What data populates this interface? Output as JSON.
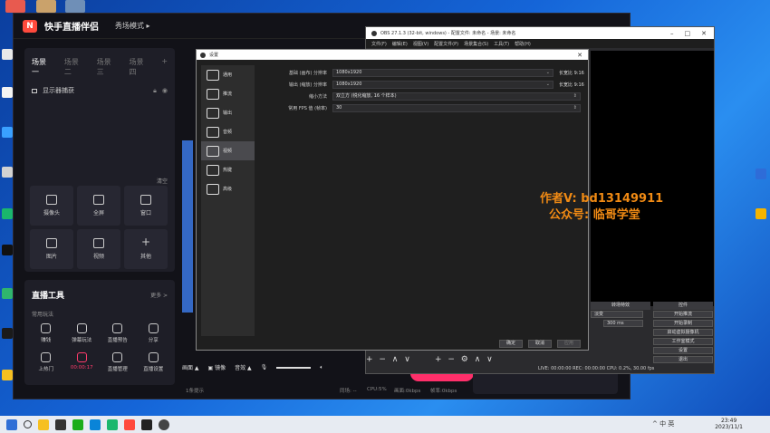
{
  "kuaishou": {
    "logo_glyph": "N",
    "app_title": "快手直播伴侣",
    "mode": "秀场模式 ▸",
    "scenes": [
      "场景一",
      "场景二",
      "场景三",
      "场景四",
      "+"
    ],
    "source_label": "显示器捕获",
    "clear": "清空",
    "grid": [
      {
        "label": "摄像头",
        "icon": "camera-icon"
      },
      {
        "label": "全屏",
        "icon": "monitor-icon"
      },
      {
        "label": "窗口",
        "icon": "window-icon"
      },
      {
        "label": "图片",
        "icon": "image-icon"
      },
      {
        "label": "视频",
        "icon": "video-icon"
      },
      {
        "label": "其他",
        "icon": "plus-icon",
        "glyph": "+"
      }
    ],
    "tools_title": "直播工具",
    "tools_more": "更多 >",
    "tools_sub": "常用玩法",
    "tools": [
      {
        "label": "赚钱"
      },
      {
        "label": "弹幕玩法"
      },
      {
        "label": "直播预告"
      },
      {
        "label": "分享"
      },
      {
        "label": "上热门"
      },
      {
        "label": "00:00:17",
        "live": true
      },
      {
        "label": "直播管理"
      },
      {
        "label": "直播设置"
      }
    ],
    "bottom": {
      "screen": "画面 ▲",
      "mirror": "镜像",
      "audio": "音效 ▲"
    },
    "status": {
      "hint": "1条提示",
      "viewers": "同场: --",
      "cpu": "CPU:5%",
      "upload": "画面:0kbps",
      "bitrate": "帧率:0kbps"
    }
  },
  "obs": {
    "title": "OBS 27.1.3 (32-bit, windows) - 配置文件: 未命名 - 场景: 未命名",
    "menu": [
      "文件(F)",
      "编辑(E)",
      "视图(V)",
      "配置文件(P)",
      "场景集合(S)",
      "工具(T)",
      "帮助(H)"
    ],
    "dock_transition": "转场特效",
    "dock_controls": "控件",
    "controls": [
      "开始推流",
      "开始录制",
      "启动虚拟摄像机",
      "工作室模式",
      "设置",
      "退出"
    ],
    "fade": "淡变",
    "duration": "300 ms",
    "status_bar": "LIVE: 00:00:00    REC: 00:00:00    CPU: 0.2%, 30.00 fps"
  },
  "settings": {
    "title": "设置",
    "nav": [
      "通用",
      "推流",
      "输出",
      "音频",
      "视频",
      "热键",
      "高级"
    ],
    "selected_nav": 4,
    "rows": [
      {
        "label": "基础 (画布) 分辨率",
        "value": "1080x1920",
        "ratio": "长宽比 9:16"
      },
      {
        "label": "输出 (缩放) 分辨率",
        "value": "1080x1920",
        "ratio": "长宽比 9:16"
      },
      {
        "label": "缩小方法",
        "value": "双立方 (锐化缩放, 16 个样本)"
      },
      {
        "label": "常用 FPS 值 (帧率)",
        "value": "30"
      }
    ],
    "buttons": [
      "确定",
      "取消",
      "应用"
    ]
  },
  "watermark": {
    "line1": "作者V: bd13149911",
    "line2": "公众号: 临哥学堂"
  },
  "taskbar": {
    "time": "23:49",
    "date": "2023/11/1",
    "tray": "^  中  英"
  }
}
